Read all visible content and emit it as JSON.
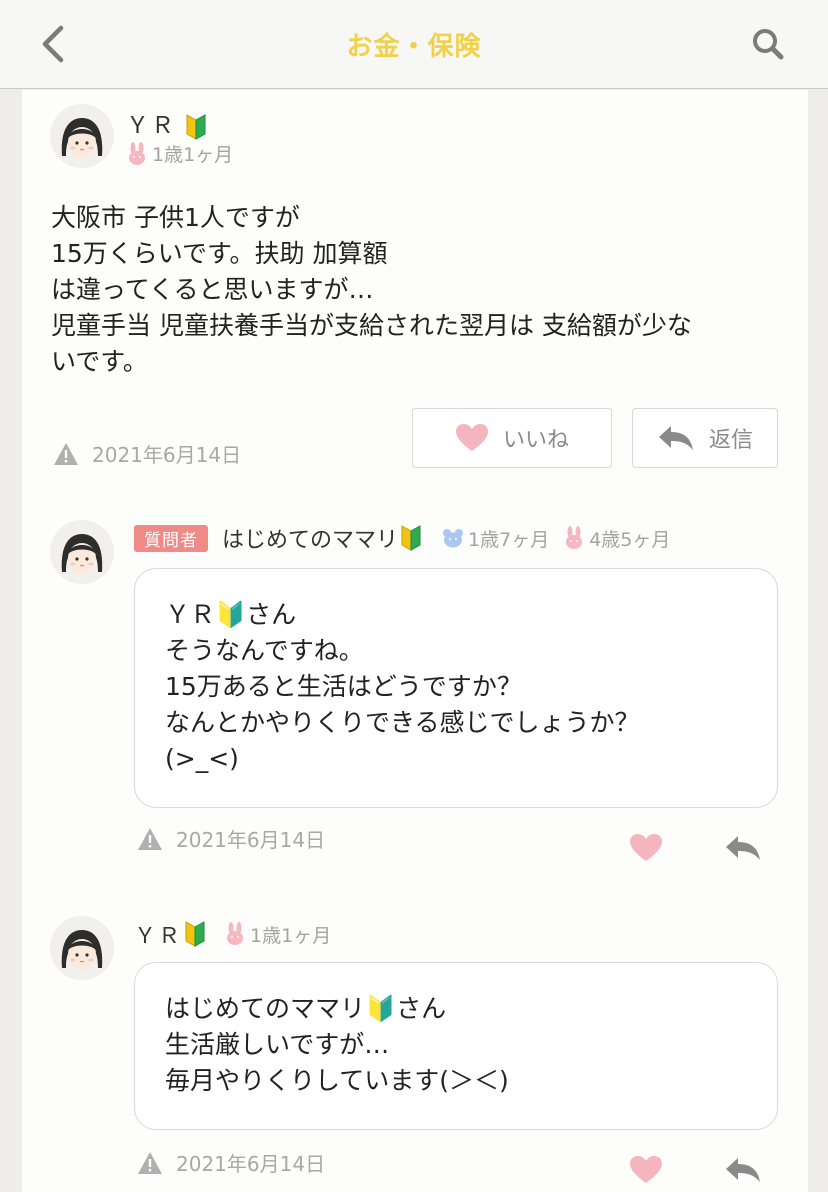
{
  "header": {
    "title": "お金・保険",
    "back_icon": "chevron-left-icon",
    "search_icon": "search-icon"
  },
  "post": {
    "author": "ＹＲ",
    "child_age": "1歳1ヶ月",
    "body_lines": [
      "大阪市 子供1人ですが",
      "15万くらいです。扶助 加算額",
      "は違ってくると思いますが…",
      "児童手当 児童扶養手当が支給された翌月は 支給額が少な",
      "いです。"
    ],
    "date": "2021年6月14日",
    "like_label": "いいね",
    "reply_label": "返信"
  },
  "reply1": {
    "badge": "質問者",
    "author": "はじめてのママリ",
    "child_age_1": "1歳7ヶ月",
    "child_age_2": "4歳5ヶ月",
    "lines": [
      "ＹＲ🔰さん",
      "そうなんですね。",
      "15万あると生活はどうですか？",
      "なんとかやりくりできる感じでしょうか？",
      "(>_<)"
    ],
    "date": "2021年6月14日"
  },
  "reply2": {
    "author": "ＹＲ",
    "child_age": "1歳1ヶ月",
    "lines": [
      "はじめてのママリ🔰さん",
      "生活厳しいですが…",
      "毎月やりくりしています(＞＜)"
    ],
    "date": "2021年6月14日"
  },
  "colors": {
    "title": "#f0d24a",
    "badge": "#ef8a86",
    "heart": "#f5b5bf"
  }
}
